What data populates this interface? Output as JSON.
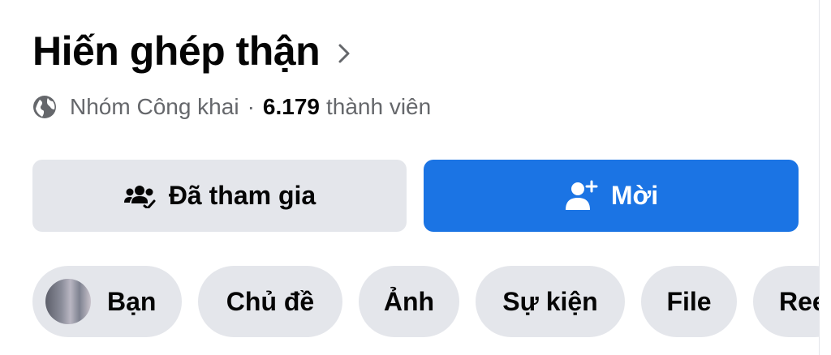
{
  "group": {
    "title": "Hiến ghép thận",
    "privacy": "Nhóm Công khai",
    "separator": "·",
    "member_count": "6.179",
    "member_label": "thành viên"
  },
  "actions": {
    "joined_label": "Đã tham gia",
    "invite_label": "Mời"
  },
  "tabs": [
    {
      "label": "Bạn"
    },
    {
      "label": "Chủ đề"
    },
    {
      "label": "Ảnh"
    },
    {
      "label": "Sự kiện"
    },
    {
      "label": "File"
    },
    {
      "label": "Reels"
    }
  ],
  "colors": {
    "primary_button": "#1b74e4",
    "secondary_button": "#e4e6eb",
    "secondary_text": "#65676b"
  },
  "icons": {
    "title_chevron": "chevron-right-icon",
    "privacy": "globe-icon",
    "joined": "group-joined-icon",
    "invite": "add-person-icon"
  }
}
